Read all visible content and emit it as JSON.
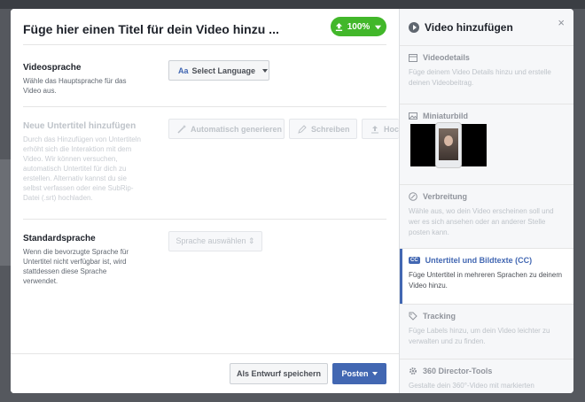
{
  "modal": {
    "title": "Füge hier einen Titel für dein Video hinzu ...",
    "progress_label": "100%",
    "colors": {
      "progress": "#42b72a",
      "primary": "#4267b2"
    }
  },
  "video_language": {
    "heading": "Videosprache",
    "description": "Wähle aus, in welcher Sprache Hauptsprache für das Video aus.",
    "select_icon": "Aa",
    "select_label": "Select Language"
  },
  "subtitles": {
    "heading": "Neue Untertitel hinzufügen",
    "description": "Durch das Hinzufügen von Untertiteln erhöht sich die Interaktion mit dem Video. Wir können versuchen, automatisch Untertitel für dich zu erstellen. Alternativ kannst du sie selbst verfassen oder eine SubRip-Datei (.srt) hochladen.",
    "buttons": [
      "Automatisch generieren",
      "Schreiben",
      "Hochladen"
    ]
  },
  "default_language": {
    "heading": "Standardsprache",
    "description": "Wenn die bevorzugte Sprache für Untertitel nicht verfügbar ist, wird stattdessen diese Sprache verwendet.",
    "select_label": "Sprache auswählen ⇕"
  },
  "footer": {
    "draft_label": "Als Entwurf speichern",
    "post_label": "Posten"
  },
  "sidebar": {
    "title": "Video hinzufügen",
    "close": "×",
    "steps": [
      {
        "icon": "calendar-icon",
        "title": "Videodetails",
        "description": "Füge deinem Video Details hinzu und erstelle deinen Videobeitrag."
      },
      {
        "icon": "image-icon",
        "title": "Miniaturbild",
        "description": ""
      },
      {
        "icon": "globe-icon",
        "title": "Verbreitung",
        "description": "Wähle aus, wo dein Video erscheinen soll und wer es sich ansehen oder an anderer Stelle posten kann."
      },
      {
        "icon": "cc-icon",
        "title": "Untertitel und Bildtexte (CC)",
        "description": "Füge Untertitel in mehreren Sprachen zu deinem Video hinzu.",
        "active": true
      },
      {
        "icon": "tag-icon",
        "title": "Tracking",
        "description": "Füge Labels hinzu, um dein Video leichter zu verwalten und zu finden."
      },
      {
        "icon": "gear-icon",
        "title": "360 Director-Tools",
        "description": "Gestalte dein 360°-Video mit markierten"
      }
    ]
  }
}
